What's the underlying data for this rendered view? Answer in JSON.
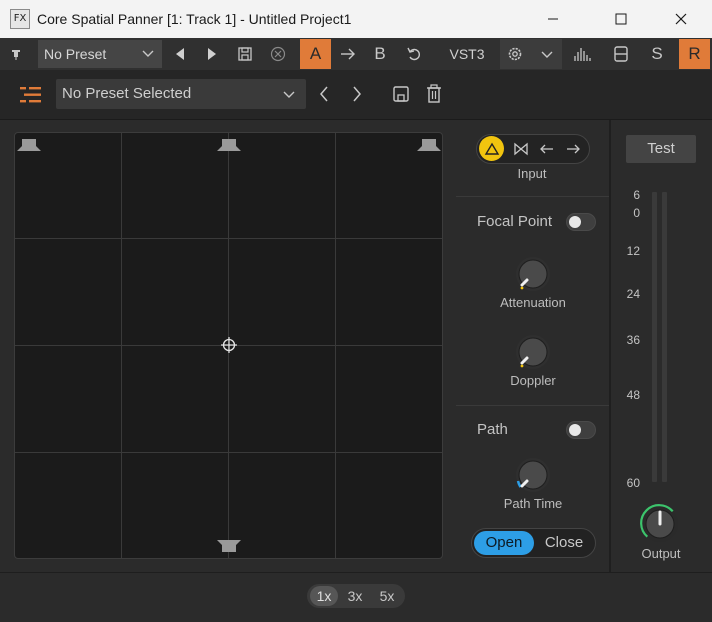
{
  "window": {
    "app_icon_text": "FX",
    "title": "Core Spatial Panner [1: Track 1] - Untitled Project1"
  },
  "host_toolbar": {
    "preset_value": "No Preset",
    "ab_a_label": "A",
    "ab_b_label": "B",
    "format_label": "VST3",
    "s_label": "S",
    "r_label": "R",
    "accent_color": "#e07b39"
  },
  "plugin_header": {
    "preset_value": "No Preset Selected"
  },
  "input": {
    "label": "Input",
    "modes": [
      "triangle-icon",
      "bowtie-icon",
      "arrow-left-icon",
      "arrow-right-icon"
    ],
    "active_color": "#f1c40f"
  },
  "focal_point": {
    "label": "Focal Point",
    "enabled": false,
    "attenuation_label": "Attenuation",
    "doppler_label": "Doppler"
  },
  "path": {
    "label": "Path",
    "enabled": false,
    "path_time_label": "Path Time",
    "open_label": "Open",
    "close_label": "Close",
    "open_color": "#2d9ee6"
  },
  "meter": {
    "test_label": "Test",
    "ticks": [
      "6",
      "0",
      "12",
      "24",
      "36",
      "48",
      "60"
    ],
    "output_label": "Output"
  },
  "zoom": {
    "options": [
      "1x",
      "3x",
      "5x"
    ],
    "selected": "1x"
  }
}
